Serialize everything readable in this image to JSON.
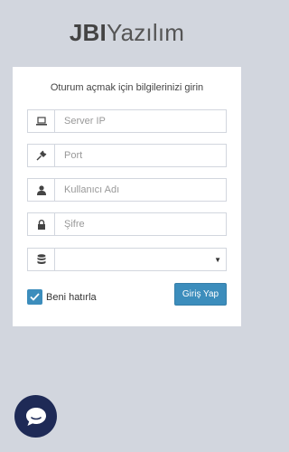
{
  "brand": {
    "bold": "JBI",
    "light": "Yazılım"
  },
  "login": {
    "subtitle": "Oturum açmak için bilgilerinizi girin",
    "server_ip_placeholder": "Server IP",
    "port_placeholder": "Port",
    "username_placeholder": "Kullanıcı Adı",
    "password_placeholder": "Şifre",
    "database_value": "",
    "remember_label": "Beni hatırla",
    "remember_checked": true,
    "submit_label": "Giriş Yap"
  },
  "icons": {
    "server": "laptop-icon",
    "port": "plug-icon",
    "user": "user-icon",
    "password": "lock-icon",
    "database": "database-icon",
    "checkbox": "check-icon",
    "chat": "chat-bubble-icon"
  },
  "colors": {
    "background": "#d2d6de",
    "primary": "#3c8dbc",
    "chat": "#1e2a56"
  }
}
